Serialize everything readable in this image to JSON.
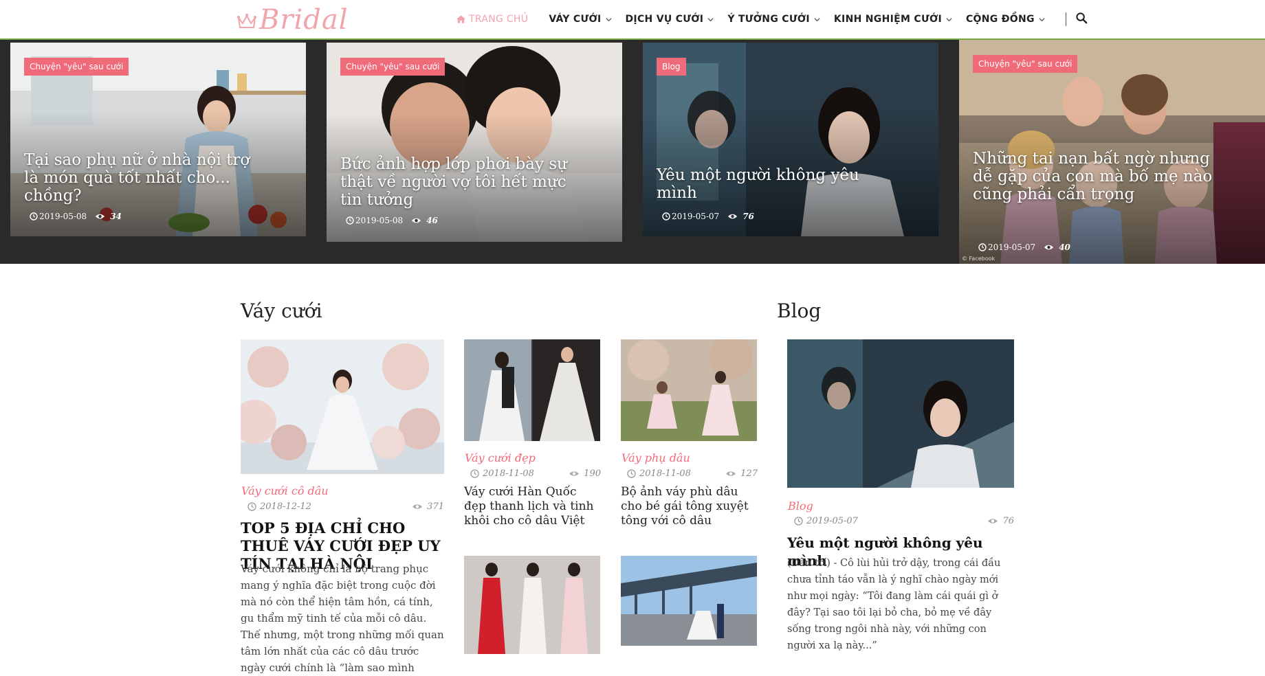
{
  "header": {
    "logo_text": "Bridal",
    "nav": [
      {
        "label": "TRANG CHỦ",
        "active": true
      },
      {
        "label": "VÁY CƯỚI"
      },
      {
        "label": "DỊCH VỤ CƯỚI"
      },
      {
        "label": "Ý TƯỞNG CƯỚI"
      },
      {
        "label": "KINH NGHIỆM CƯỚI"
      },
      {
        "label": "CỘNG ĐỒNG"
      }
    ],
    "icons": {
      "home": "home-icon",
      "search": "search-icon",
      "dropdown": "chevron-down-icon"
    }
  },
  "hero": [
    {
      "tag": "Chuyện \"yêu\" sau cưới",
      "title": "Tại sao phụ nữ ở nhà nội trợ là món quà tốt nhất cho... chồng?",
      "date": "2019-05-08",
      "views": "34"
    },
    {
      "tag": "Chuyện \"yêu\" sau cưới",
      "title": "Bức ảnh hợp lớp phơi bày sự thật về người vợ tôi hết mực tin tưởng",
      "date": "2019-05-08",
      "views": "46"
    },
    {
      "tag": "Blog",
      "title": "Yêu một người không yêu mình",
      "date": "2019-05-07",
      "views": "76"
    },
    {
      "tag": "Chuyện \"yêu\" sau cưới",
      "title": "Những tai nạn bất ngờ nhưng dễ gặp của con mà bố mẹ nào cũng phải cẩn trọng",
      "date": "2019-05-07",
      "views": "40",
      "credit": "© Facebook"
    }
  ],
  "vay_cuoi": {
    "heading": "Váy cưới",
    "featured": {
      "category": "Váy cưới cô dâu",
      "date": "2018-12-12",
      "views": "371",
      "title": "TOP 5 ĐỊA CHỈ CHO THUÊ VÁY CƯỚI ĐẸP UY TÍN TẠI HÀ NỘI",
      "excerpt": "Váy cưới không chỉ là bộ trang phục mang ý nghĩa đặc biệt trong cuộc đời mà nó còn thể hiện tâm hồn, cá tính, gu thẩm mỹ tinh tế của mỗi cô dâu. Thế nhưng, một trong những mối quan tâm lớn nhất của các cô dâu trước ngày cưới chính là “làm sao mình"
    },
    "posts": [
      {
        "category": "Váy cưới đẹp",
        "date": "2018-11-08",
        "views": "190",
        "title": "Váy cưới Hàn Quốc đẹp thanh lịch và tinh khôi cho cô dâu Việt"
      },
      {
        "category": "Váy phụ dâu",
        "date": "2018-11-08",
        "views": "127",
        "title": "Bộ ảnh váy phù dâu cho bé gái tông xuyệt tông với cô dâu"
      }
    ]
  },
  "blog": {
    "heading": "Blog",
    "featured": {
      "category": "Blog",
      "date": "2019-05-07",
      "views": "76",
      "title": "Yêu một người không yêu mình",
      "excerpt": "(Dân trí) - Cô lùi hủi trở dậy, trong cái đầu chưa tỉnh táo vẫn là ý nghĩ chào ngày mới như mọi ngày: “Tôi đang làm cái quái gì ở đây? Tại sao tôi lại bỏ cha, bỏ mẹ về đây sống trong ngôi nhà này, với những con người xa lạ này...”"
    }
  },
  "colors": {
    "accent": "#f06b7a",
    "logo": "#f0a4ab",
    "hero_bg": "#2a2a2a",
    "header_line": "#79a843"
  }
}
